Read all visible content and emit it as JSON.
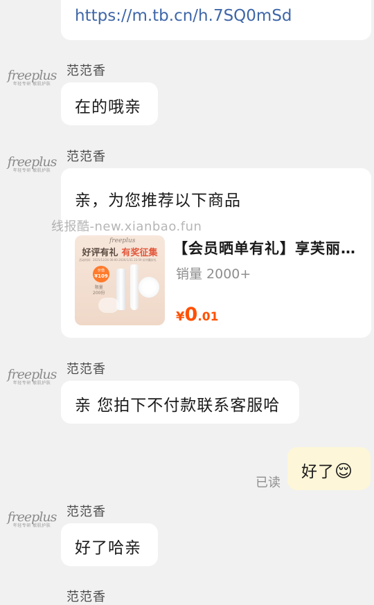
{
  "link_message": {
    "url": "https://m.tb.cn/h.7SQ0mSd"
  },
  "agent": {
    "name": "范范香",
    "avatar_logo": "freeplus",
    "avatar_tag": "年轻专研 敏肌护肤"
  },
  "messages": {
    "m1": "在的哦亲",
    "m2_title": "亲，为您推荐以下商品",
    "m3": "亲 您拍下不付款联系客服哈",
    "m4_user": "好了",
    "m4_emoji": "😌",
    "m4_status": "已读",
    "m5": "好了哈亲"
  },
  "product": {
    "title": "【会员晒单有礼】享芙丽…",
    "sales": "销量 2000+",
    "currency": "¥",
    "price_int": "0",
    "price_dec": ".01",
    "thumb": {
      "brand": "freeplus",
      "headline_a": "好评有礼",
      "headline_b": "有奖征集",
      "sub": "活动时间：2025/12/26 00:00-2026/1/31 23:59 好评赢好礼",
      "badge_top": "价值",
      "badge_value": "¥109",
      "limit_a": "限量",
      "limit_b": "200份"
    }
  },
  "watermark": "线报酷-new.xianbao.fun",
  "colors": {
    "background": "#f1f1f1",
    "bubble": "#ffffff",
    "link": "#3e66a8",
    "price": "#ff5000",
    "user_bubble": "#fdf6d8"
  }
}
